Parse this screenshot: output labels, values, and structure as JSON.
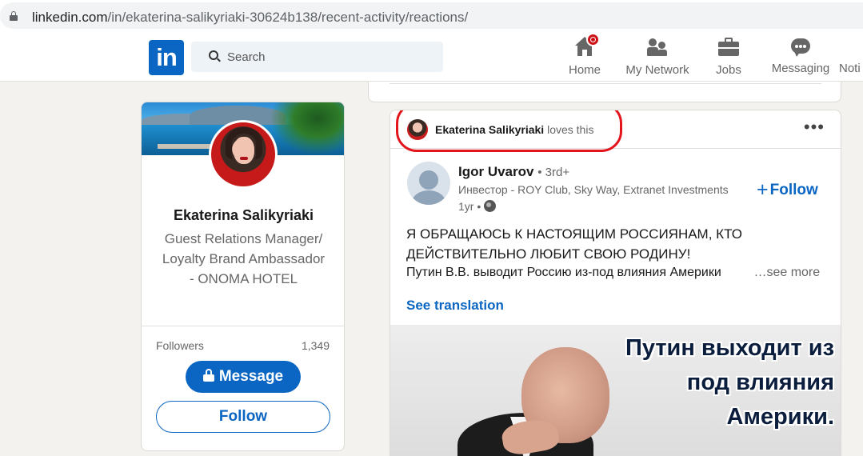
{
  "browser": {
    "url_host": "linkedin.com",
    "url_path": "/in/ekaterina-salikyriaki-30624b138/recent-activity/reactions/"
  },
  "nav": {
    "logo": "in",
    "search_placeholder": "Search",
    "items": [
      {
        "label": "Home",
        "icon": "home-icon"
      },
      {
        "label": "My Network",
        "icon": "my-network-icon"
      },
      {
        "label": "Jobs",
        "icon": "jobs-icon"
      },
      {
        "label": "Messaging",
        "icon": "messaging-icon"
      },
      {
        "label": "Noti",
        "icon": "notifications-icon"
      }
    ]
  },
  "profile": {
    "name": "Ekaterina Salikyriaki",
    "headline": "Guest Relations Manager/ Loyalty Brand Ambassador - ONOMA HOTEL",
    "followers_label": "Followers",
    "followers_count": "1,349",
    "message_button": "Message",
    "follow_button": "Follow"
  },
  "activity": {
    "actor": "Ekaterina Salikyriaki",
    "verb": "loves this",
    "more_icon": "more-options-icon"
  },
  "post": {
    "author_name": "Igor Uvarov",
    "author_degree": "• 3rd+",
    "author_title": "Инвестор - ROY Club, Sky Way, Extranet Investments",
    "time": "1yr •",
    "follow_label": "Follow",
    "text_heading": "Я ОБРАЩАЮСЬ К НАСТОЯЩИМ РОССИЯНАМ, КТО ДЕЙСТВИТЕЛЬНО ЛЮБИТ СВОЮ РОДИНУ!",
    "text_line": "Путин В.В. выводит Россию из-под влияния Америки",
    "see_more": "…see more",
    "see_translation": "See translation",
    "image_caption_1": "Путин выходит из",
    "image_caption_2": "под влияния",
    "image_caption_3": "Америки."
  },
  "colors": {
    "linkedin_blue": "#0a66c2",
    "annotation_red": "#e3141b",
    "page_bg": "#f3f2ef"
  }
}
